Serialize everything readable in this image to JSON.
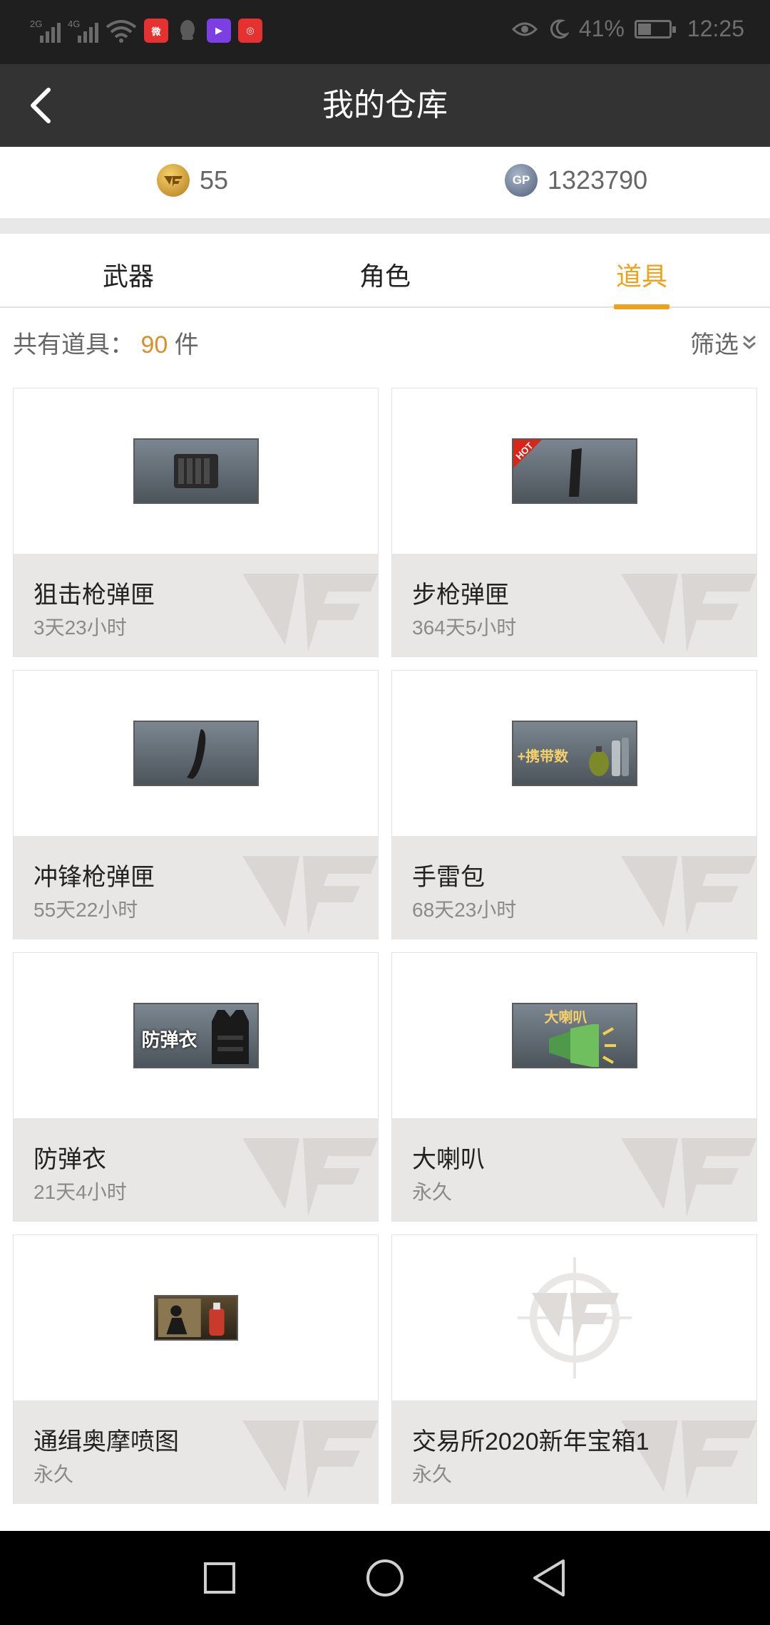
{
  "status_bar": {
    "net_left": "2G",
    "net_right": "4G",
    "battery": "41%",
    "time": "12:25",
    "apps": [
      "weibo-icon",
      "qq-icon",
      "video-icon",
      "game-icon"
    ]
  },
  "header": {
    "title": "我的仓库"
  },
  "currency": {
    "cf_points": "55",
    "gp_points": "1323790",
    "gp_badge": "GP"
  },
  "tabs": [
    {
      "label": "武器",
      "active": false
    },
    {
      "label": "角色",
      "active": false
    },
    {
      "label": "道具",
      "active": true
    }
  ],
  "summary": {
    "prefix": "共有道具：",
    "count": "90",
    "unit": "件",
    "filter_label": "筛选"
  },
  "items": [
    {
      "name": "狙击枪弹匣",
      "duration": "3天23小时",
      "thumb": "sniper-magazine",
      "badge": ""
    },
    {
      "name": "步枪弹匣",
      "duration": "364天5小时",
      "thumb": "rifle-magazine",
      "badge": "HOT"
    },
    {
      "name": "冲锋枪弹匣",
      "duration": "55天22小时",
      "thumb": "smg-magazine",
      "badge": ""
    },
    {
      "name": "手雷包",
      "duration": "68天23小时",
      "thumb": "grenade-pack",
      "badge": "+携带数"
    },
    {
      "name": "防弹衣",
      "duration": "21天4小时",
      "thumb": "body-armor",
      "badge": "防弹衣"
    },
    {
      "name": "大喇叭",
      "duration": "永久",
      "thumb": "loudspeaker",
      "badge": "大喇叭"
    },
    {
      "name": "通缉奥摩喷图",
      "duration": "永久",
      "thumb": "spray-paint",
      "badge": ""
    },
    {
      "name": "交易所2020新年宝箱1",
      "duration": "永久",
      "thumb": "cf-logo-placeholder",
      "badge": ""
    }
  ],
  "colors": {
    "accent": "#f0a11c",
    "title_bar": "#333333",
    "card_info_bg": "#e9e7e5"
  }
}
